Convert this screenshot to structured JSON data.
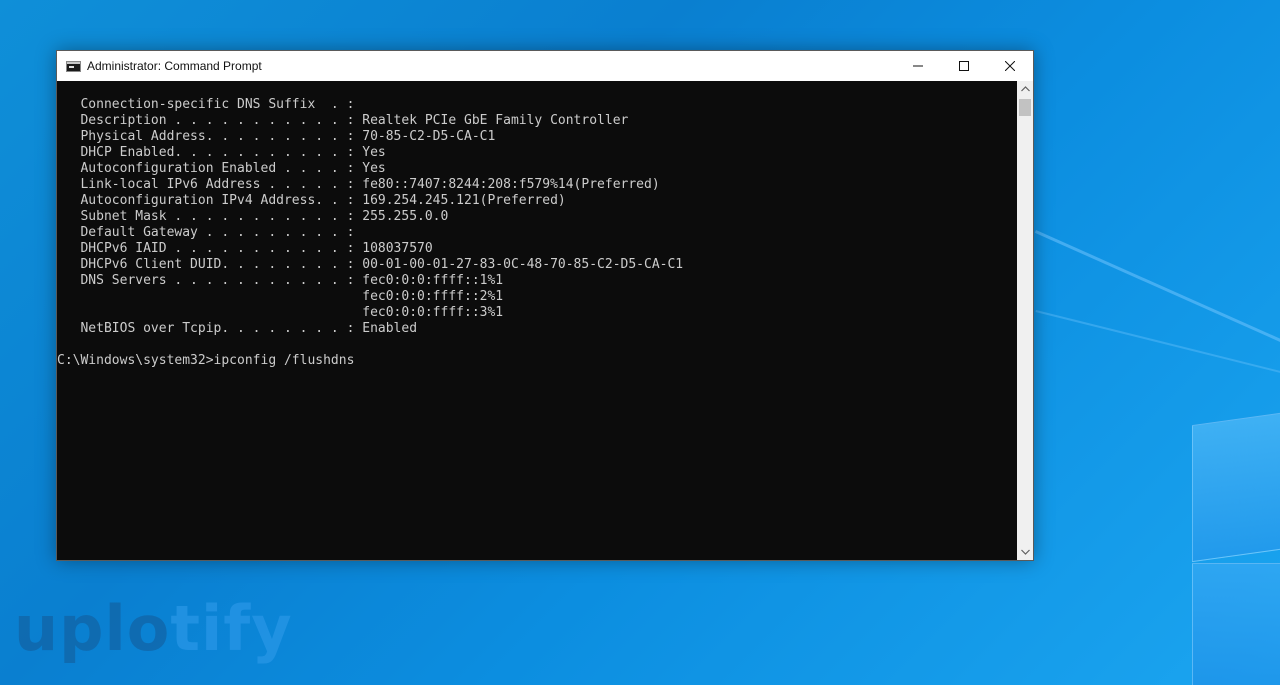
{
  "window": {
    "title": "Administrator: Command Prompt",
    "icon": "cmd-icon",
    "controls": {
      "minimize": "minimize-icon",
      "maximize": "maximize-icon",
      "close": "close-icon"
    }
  },
  "console": {
    "lines": [
      "   Connection-specific DNS Suffix  . :",
      "   Description . . . . . . . . . . . : Realtek PCIe GbE Family Controller",
      "   Physical Address. . . . . . . . . : 70-85-C2-D5-CA-C1",
      "   DHCP Enabled. . . . . . . . . . . : Yes",
      "   Autoconfiguration Enabled . . . . : Yes",
      "   Link-local IPv6 Address . . . . . : fe80::7407:8244:208:f579%14(Preferred)",
      "   Autoconfiguration IPv4 Address. . : 169.254.245.121(Preferred)",
      "   Subnet Mask . . . . . . . . . . . : 255.255.0.0",
      "   Default Gateway . . . . . . . . . :",
      "   DHCPv6 IAID . . . . . . . . . . . : 108037570",
      "   DHCPv6 Client DUID. . . . . . . . : 00-01-00-01-27-83-0C-48-70-85-C2-D5-CA-C1",
      "   DNS Servers . . . . . . . . . . . : fec0:0:0:ffff::1%1",
      "                                       fec0:0:0:ffff::2%1",
      "                                       fec0:0:0:ffff::3%1",
      "   NetBIOS over Tcpip. . . . . . . . : Enabled",
      "",
      "C:\\Windows\\system32>ipconfig /flushdns"
    ]
  },
  "watermark": {
    "part1": "uplo",
    "part2": "tify"
  },
  "colors": {
    "desktop": "#0a7fd0",
    "console_bg": "#0c0c0c",
    "console_text": "#cccccc"
  }
}
